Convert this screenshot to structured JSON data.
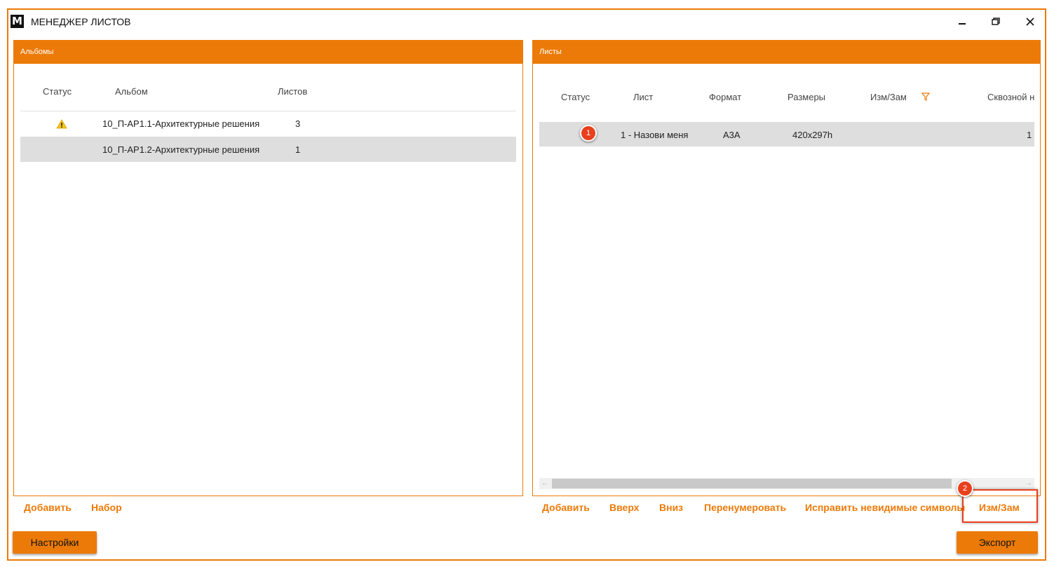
{
  "app": {
    "logo_letter": "M",
    "title": "МЕНЕДЖЕР ЛИСТОВ"
  },
  "albums_panel": {
    "header": "Альбомы",
    "columns": {
      "status": "Статус",
      "album": "Альбом",
      "sheets": "Листов"
    },
    "rows": [
      {
        "status_icon": "warning-icon",
        "album": "10_П-АР1.1-Архитектурные решения",
        "sheets": "3",
        "selected": false
      },
      {
        "status_icon": "",
        "album": "10_П-АР1.2-Архитектурные решения",
        "sheets": "1",
        "selected": true
      }
    ],
    "buttons": {
      "add": "Добавить",
      "set": "Набор"
    }
  },
  "sheets_panel": {
    "header": "Листы",
    "columns": {
      "status": "Статус",
      "sheet": "Лист",
      "format": "Формат",
      "size": "Размеры",
      "change": "Изм/Зам",
      "through": "Сквозной н"
    },
    "rows": [
      {
        "sheet": "1 - Назови меня",
        "format": "А3А",
        "size": "420x297h",
        "through": "1"
      }
    ],
    "buttons": {
      "add": "Добавить",
      "up": "Вверх",
      "down": "Вниз",
      "renumber": "Перенумеровать",
      "fix": "Исправить невидимые символы",
      "change": "Изм/Зам"
    }
  },
  "footer": {
    "settings": "Настройки",
    "export": "Экспорт"
  },
  "annotations": {
    "badge1": "1",
    "badge2": "2"
  },
  "colors": {
    "accent": "#ec7a08",
    "badge": "#e8401d",
    "selected_row": "#dedede"
  }
}
